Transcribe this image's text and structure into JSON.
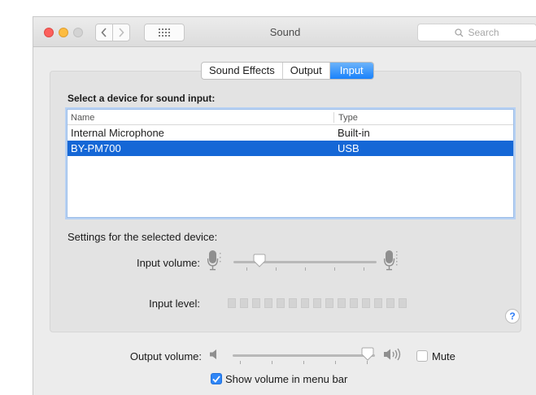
{
  "window": {
    "title": "Sound",
    "search_placeholder": "Search"
  },
  "tabs": [
    {
      "label": "Sound Effects",
      "active": false
    },
    {
      "label": "Output",
      "active": false
    },
    {
      "label": "Input",
      "active": true
    }
  ],
  "input": {
    "select_label": "Select a device for sound input:",
    "columns": {
      "name": "Name",
      "type": "Type"
    },
    "devices": [
      {
        "name": "Internal Microphone",
        "type": "Built-in",
        "selected": false
      },
      {
        "name": "BY-PM700",
        "type": "USB",
        "selected": true
      }
    ],
    "settings_label": "Settings for the selected device:",
    "volume_label": "Input volume:",
    "volume_value": 0.18,
    "level_label": "Input level:",
    "level_segments": 15,
    "help": "?"
  },
  "output": {
    "volume_label": "Output volume:",
    "volume_value": 0.95,
    "mute_label": "Mute",
    "mute_checked": false,
    "show_menu_bar_label": "Show volume in menu bar",
    "show_menu_bar_checked": true
  },
  "colors": {
    "accent": "#1a82fb",
    "selection": "#1567d6"
  }
}
